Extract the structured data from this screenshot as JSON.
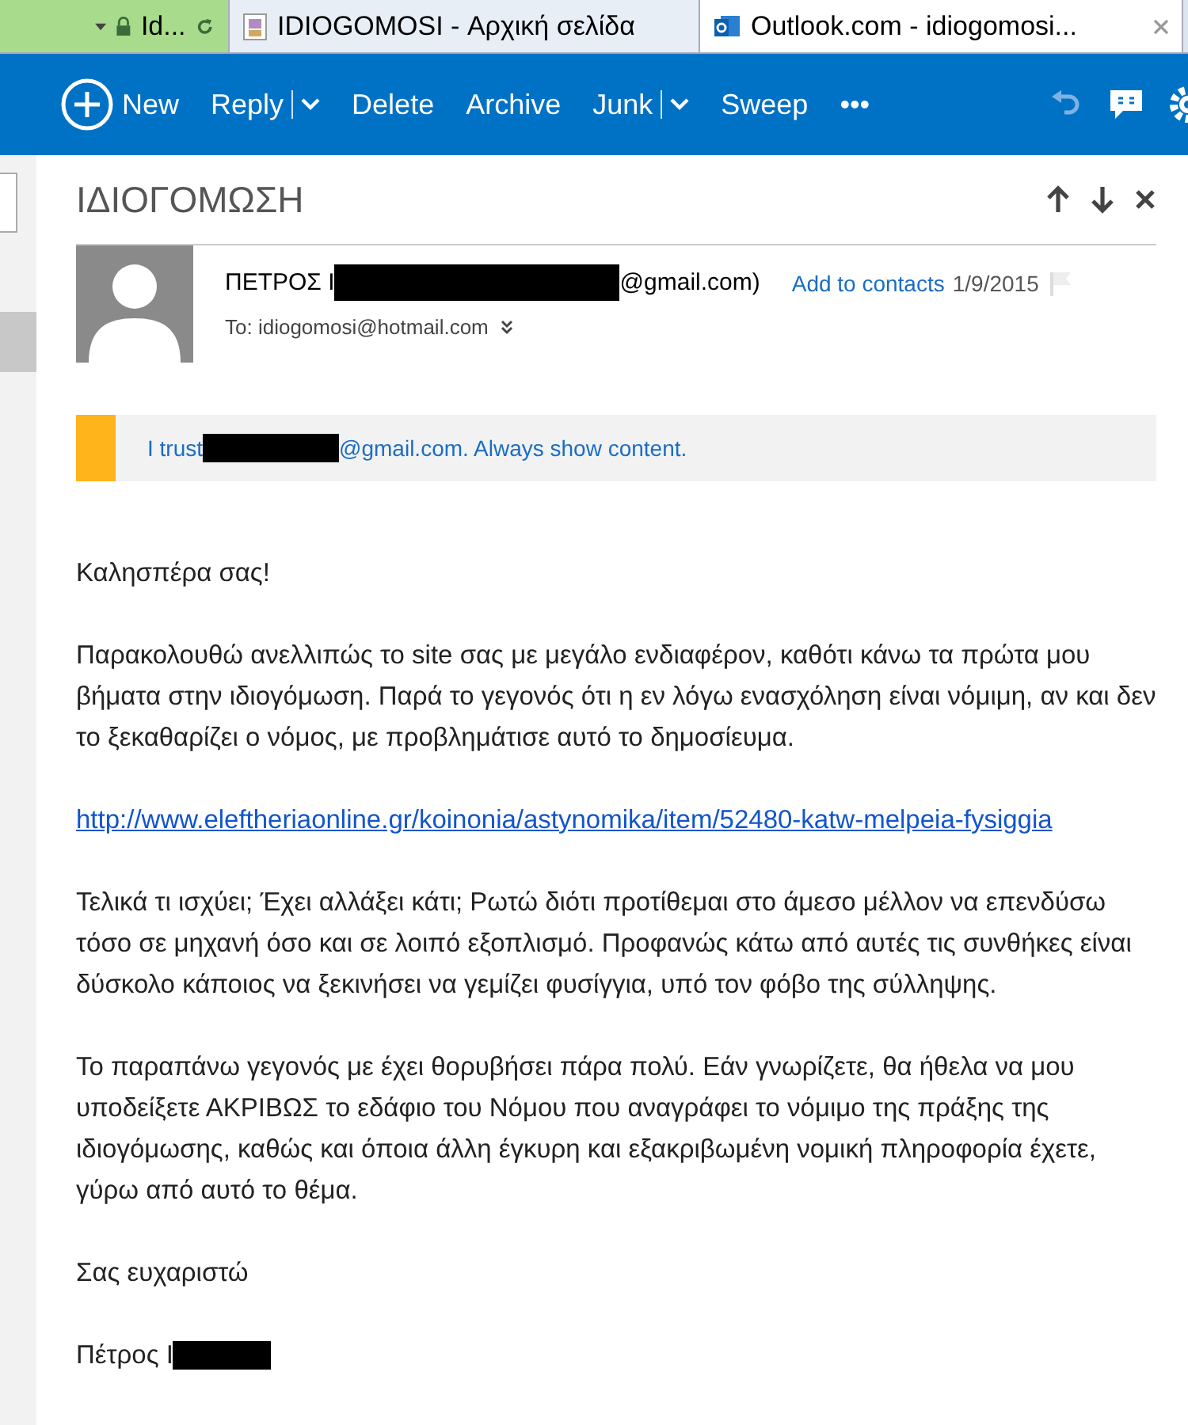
{
  "browser_tabs": [
    {
      "label": "Id...",
      "selected": false,
      "kind": "address"
    },
    {
      "label": "IDIOGOMOSI - Αρχική σελίδα",
      "selected": false,
      "kind": "page"
    },
    {
      "label": "Outlook.com - idiogomosi...",
      "selected": true,
      "kind": "mail"
    }
  ],
  "toolbar": {
    "items": [
      {
        "label": "New",
        "kind": "new"
      },
      {
        "label": "Reply",
        "kind": "split"
      },
      {
        "label": "Delete",
        "kind": "plain"
      },
      {
        "label": "Archive",
        "kind": "plain"
      },
      {
        "label": "Junk",
        "kind": "split"
      },
      {
        "label": "Sweep",
        "kind": "plain"
      },
      {
        "label": "•••",
        "kind": "plain"
      }
    ]
  },
  "message": {
    "subject": "ΙΔΙΟΓΟΜΩΣΗ",
    "sender_prefix": "ΠΕΤΡΟΣ Ι",
    "sender_suffix": "@gmail.com)",
    "add_contact": "Add to contacts",
    "date": "1/9/2015",
    "to": "To: idiogomosi@hotmail.com",
    "trust_prefix": "I trust",
    "trust_suffix": "@gmail.com. Always show content.",
    "body": [
      {
        "kind": "text",
        "text": "Καλησπέρα σας!"
      },
      {
        "kind": "text",
        "text": "Παρακολουθώ ανελλιπώς το site σας με μεγάλο ενδιαφέρον, καθότι κάνω τα πρώτα μου βήματα στην ιδιογόμωση. Παρά το γεγονός ότι η εν λόγω ενασχόληση είναι νόμιμη, αν και δεν το ξεκαθαρίζει ο νόμος, με προβλημάτισε αυτό το δημοσίευμα."
      },
      {
        "kind": "link",
        "text": "http://www.eleftheriaonline.gr/koinonia/astynomika/item/52480-katw-melpeia-fysiggia"
      },
      {
        "kind": "text",
        "text": "Τελικά τι ισχύει; Έχει αλλάξει κάτι; Ρωτώ διότι προτίθεμαι στο άμεσο μέλλον να επενδύσω τόσο σε μηχανή όσο και σε λοιπό εξοπλισμό. Προφανώς κάτω από αυτές τις συνθήκες είναι δύσκολο κάποιος να ξεκινήσει να γεμίζει φυσίγγια, υπό τον φόβο της σύλληψης."
      },
      {
        "kind": "text",
        "text": "Το παραπάνω γεγονός με έχει θορυβήσει πάρα πολύ. Εάν γνωρίζετε, θα ήθελα να μου υποδείξετε ΑΚΡΙΒΩΣ το εδάφιο του Νόμου που αναγράφει το νόμιμο της πράξης της ιδιογόμωσης, καθώς και όποια άλλη έγκυρη και εξακριβωμένη νομική  πληροφορία έχετε, γύρω από αυτό το θέμα."
      },
      {
        "kind": "text",
        "text": "Σας ευχαριστώ"
      },
      {
        "kind": "signature",
        "text": "Πέτρος Ι"
      }
    ]
  }
}
